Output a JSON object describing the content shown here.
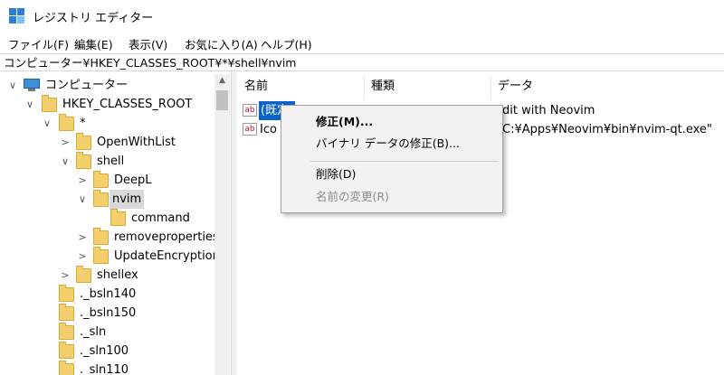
{
  "window": {
    "title": "レジストリ エディター"
  },
  "menu": [
    {
      "label": "ファイル(F)"
    },
    {
      "label": "編集(E)"
    },
    {
      "label": "表示(V)"
    },
    {
      "label": "お気に入り(A)"
    },
    {
      "label": "ヘルプ(H)"
    }
  ],
  "address": {
    "path": "コンピューター¥HKEY_CLASSES_ROOT¥*¥shell¥nvim"
  },
  "tree": {
    "nodes": [
      {
        "label": "コンピューター",
        "chevron": "∨"
      },
      {
        "label": "HKEY_CLASSES_ROOT",
        "chevron": "∨"
      },
      {
        "label": "*",
        "chevron": "∨"
      },
      {
        "label": "OpenWithList",
        "chevron": ">"
      },
      {
        "label": "shell",
        "chevron": "∨"
      },
      {
        "label": "DeepL",
        "chevron": ">"
      },
      {
        "label": "nvim",
        "chevron": "∨"
      },
      {
        "label": "command",
        "chevron": ""
      },
      {
        "label": "removeproperties",
        "chevron": ">"
      },
      {
        "label": "UpdateEncryption",
        "chevron": ">"
      },
      {
        "label": "shellex",
        "chevron": ">"
      },
      {
        "label": "._bsln140",
        "chevron": ""
      },
      {
        "label": "._bsln150",
        "chevron": ""
      },
      {
        "label": "._sln",
        "chevron": ""
      },
      {
        "label": "._sln100",
        "chevron": ""
      },
      {
        "label": "._sln110",
        "chevron": ""
      }
    ]
  },
  "list": {
    "columns": {
      "name": "名前",
      "type": "種類",
      "data": "データ"
    },
    "rows": [
      {
        "name": "(既定)",
        "data": "dit with Neovim",
        "icon": "ab"
      },
      {
        "name": "Ico",
        "data": "C:¥Apps¥Neovim¥bin¥nvim-qt.exe\"",
        "icon": "ab"
      }
    ]
  },
  "context_menu": {
    "items": [
      {
        "label": "修正(M)..."
      },
      {
        "label": "バイナリ データの修正(B)..."
      },
      {
        "label": "削除(D)"
      },
      {
        "label": "名前の変更(R)"
      }
    ]
  },
  "colors": {
    "selection": "#0a64c8",
    "folder": "#f3cf6e"
  }
}
